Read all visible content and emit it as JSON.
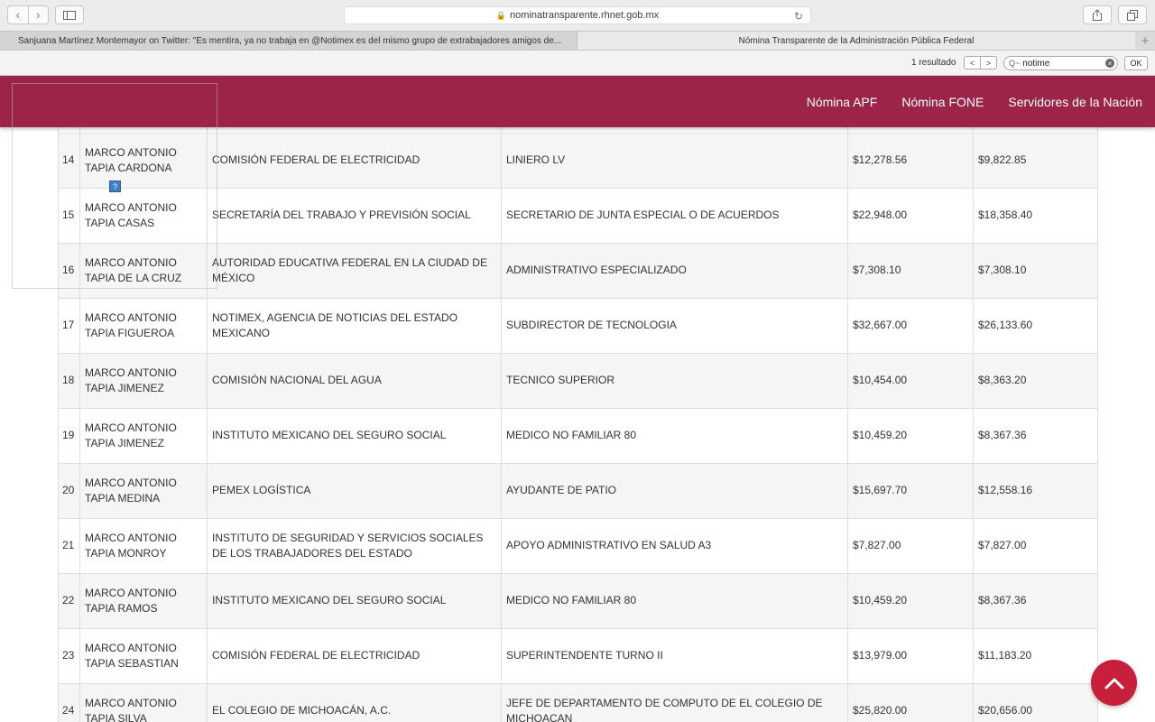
{
  "browser": {
    "url": "nominatransparente.rhnet.gob.mx",
    "tabs": [
      {
        "title": "Sanjuana Martínez Montemayor on Twitter: \"Es mentira, ya no trabaja en @Notimex es del mismo grupo de extrabajadores amigos de..."
      },
      {
        "title": "Nómina Transparente de la Administración Pública Federal"
      }
    ],
    "find": {
      "count": "1 resultado",
      "query": "notime",
      "ok_label": "OK"
    }
  },
  "site": {
    "brand_color": "#9c2449",
    "nav": [
      "Nómina APF",
      "Nómina FONE",
      "Servidores de la Nación"
    ]
  },
  "table": {
    "rows": [
      {
        "n": "14",
        "name": "MARCO ANTONIO TAPIA CARDONA",
        "institution": "COMISIÓN FEDERAL DE ELECTRICIDAD",
        "position": "LINIERO LV",
        "gross": "$12,278.56",
        "net": "$9,822.85"
      },
      {
        "n": "15",
        "name": "MARCO ANTONIO TAPIA CASAS",
        "institution": "SECRETARÍA DEL TRABAJO Y PREVISIÓN SOCIAL",
        "position": "SECRETARIO DE JUNTA ESPECIAL O DE ACUERDOS",
        "gross": "$22,948.00",
        "net": "$18,358.40"
      },
      {
        "n": "16",
        "name": "MARCO ANTONIO TAPIA DE LA CRUZ",
        "institution": "AUTORIDAD EDUCATIVA FEDERAL EN LA CIUDAD DE MÉXICO",
        "position": "ADMINISTRATIVO ESPECIALIZADO",
        "gross": "$7,308.10",
        "net": "$7,308.10"
      },
      {
        "n": "17",
        "name": "MARCO ANTONIO TAPIA FIGUEROA",
        "institution": "NOTIMEX, AGENCIA DE NOTICIAS DEL ESTADO MEXICANO",
        "position": "SUBDIRECTOR DE TECNOLOGIA",
        "gross": "$32,667.00",
        "net": "$26,133.60"
      },
      {
        "n": "18",
        "name": "MARCO ANTONIO TAPIA JIMENEZ",
        "institution": "COMISIÓN NACIONAL DEL AGUA",
        "position": "TECNICO SUPERIOR",
        "gross": "$10,454.00",
        "net": "$8,363.20"
      },
      {
        "n": "19",
        "name": "MARCO ANTONIO TAPIA JIMENEZ",
        "institution": "INSTITUTO MEXICANO DEL SEGURO SOCIAL",
        "position": "MEDICO NO FAMILIAR 80",
        "gross": "$10,459.20",
        "net": "$8,367.36"
      },
      {
        "n": "20",
        "name": "MARCO ANTONIO TAPIA MEDINA",
        "institution": "PEMEX LOGÍSTICA",
        "position": "AYUDANTE DE PATIO",
        "gross": "$15,697.70",
        "net": "$12,558.16"
      },
      {
        "n": "21",
        "name": "MARCO ANTONIO TAPIA MONROY",
        "institution": "INSTITUTO DE SEGURIDAD Y SERVICIOS SOCIALES DE LOS TRABAJADORES DEL ESTADO",
        "position": "APOYO ADMINISTRATIVO EN SALUD A3",
        "gross": "$7,827.00",
        "net": "$7,827.00"
      },
      {
        "n": "22",
        "name": "MARCO ANTONIO TAPIA RAMOS",
        "institution": "INSTITUTO MEXICANO DEL SEGURO SOCIAL",
        "position": "MEDICO NO FAMILIAR 80",
        "gross": "$10,459.20",
        "net": "$8,367.36"
      },
      {
        "n": "23",
        "name": "MARCO ANTONIO TAPIA SEBASTIAN",
        "institution": "COMISIÓN FEDERAL DE ELECTRICIDAD",
        "position": "SUPERINTENDENTE TURNO II",
        "gross": "$13,979.00",
        "net": "$11,183.20"
      },
      {
        "n": "24",
        "name": "MARCO ANTONIO TAPIA SILVA",
        "institution": "EL COLEGIO DE MICHOACÁN, A.C.",
        "position": "JEFE DE DEPARTAMENTO DE COMPUTO DE EL COLEGIO DE MICHOACAN",
        "gross": "$25,820.00",
        "net": "$20,656.00"
      }
    ]
  }
}
